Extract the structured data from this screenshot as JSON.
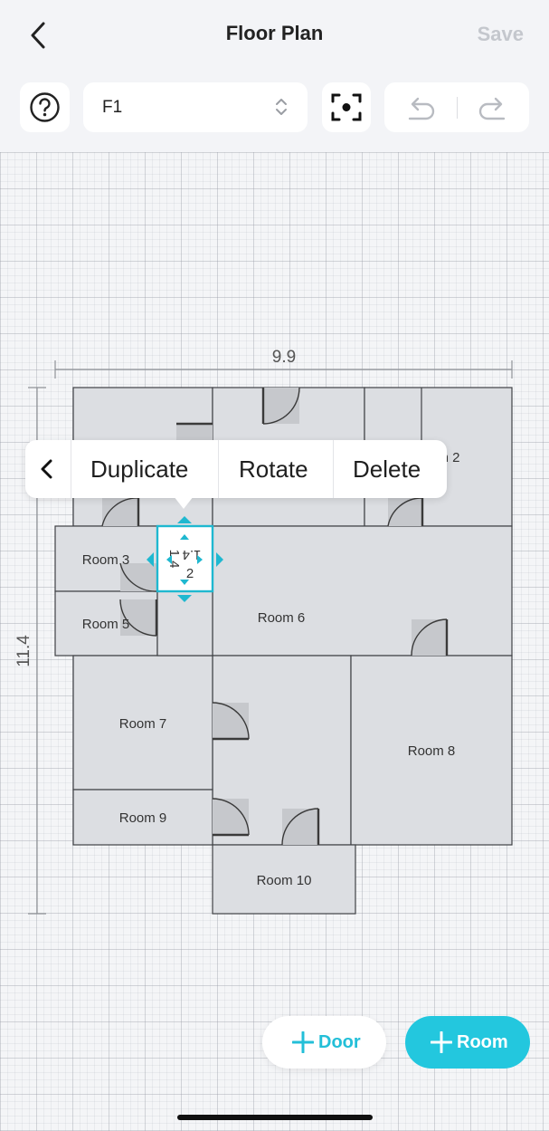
{
  "header": {
    "title": "Floor Plan",
    "save_label": "Save"
  },
  "toolbar": {
    "floor": "F1"
  },
  "plan": {
    "width_dim": "9.9",
    "height_dim": "11.4",
    "rooms": [
      "Room 3",
      "Room 5",
      "Room 6",
      "Room 7",
      "Room 8",
      "Room 9",
      "Room 10"
    ],
    "partial_room_label": "n 2",
    "selected": {
      "dim_a": "1.4",
      "dim_b": "1.4",
      "dim_c": "2"
    }
  },
  "context_menu": {
    "duplicate": "Duplicate",
    "rotate": "Rotate",
    "delete": "Delete"
  },
  "actions": {
    "door": "Door",
    "room": "Room"
  },
  "colors": {
    "accent": "#23c7de",
    "room_fill": "#dcdee2",
    "wall": "#3a3a3a",
    "selection": "#1fb8d0"
  }
}
